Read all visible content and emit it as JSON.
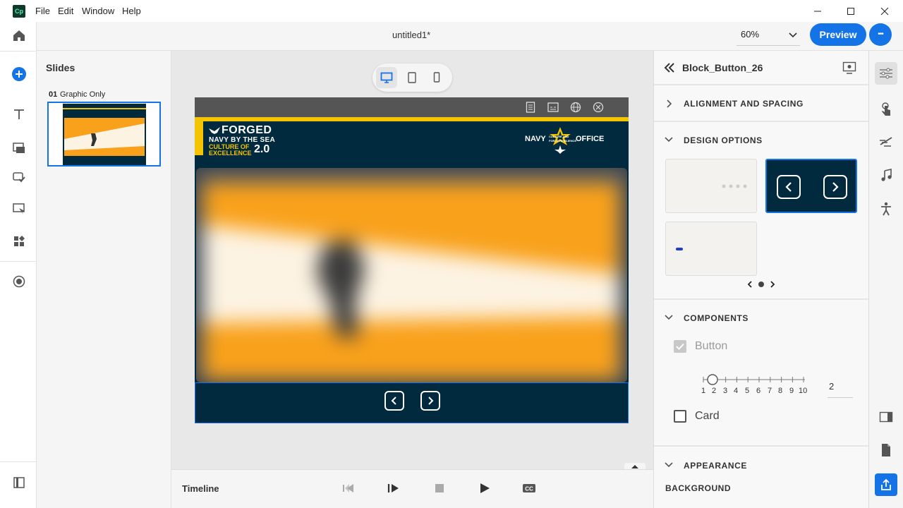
{
  "app": {
    "logo": "Cp"
  },
  "menu": {
    "file": "File",
    "edit": "Edit",
    "window": "Window",
    "help": "Help"
  },
  "header": {
    "doc_title": "untitled1*",
    "zoom": "60%",
    "preview_label": "Preview",
    "more_label": "•••"
  },
  "slides": {
    "title": "Slides",
    "items": [
      {
        "number": "01",
        "name": "Graphic Only"
      }
    ]
  },
  "slide": {
    "forged": "FORGED",
    "navy_by_the_sea": "NAVY BY THE SEA",
    "culture_of": "CULTURE OF",
    "excellence": "EXCELLENCE",
    "version": "2.0",
    "office_left": "NAVY",
    "office_small_1": "CULTURE AND",
    "office_small_2": "FORCE RESILIENCE",
    "office_right": "OFFICE"
  },
  "timeline": {
    "label": "Timeline"
  },
  "properties": {
    "object_name": "Block_Button_26",
    "sections": {
      "alignment": "ALIGNMENT AND SPACING",
      "design": "DESIGN OPTIONS",
      "components": "COMPONENTS",
      "appearance": "APPEARANCE"
    },
    "components": {
      "button_label": "Button",
      "button_checked": true,
      "card_label": "Card",
      "card_checked": false,
      "slider_ticks": [
        "1",
        "2",
        "3",
        "4",
        "5",
        "6",
        "7",
        "8",
        "9",
        "10"
      ],
      "slider_value": "2"
    },
    "background_label": "BACKGROUND"
  },
  "colors": {
    "accent": "#1473e6",
    "navy": "#022a3e",
    "gold": "#f5c400",
    "orange": "#f9a11b"
  }
}
